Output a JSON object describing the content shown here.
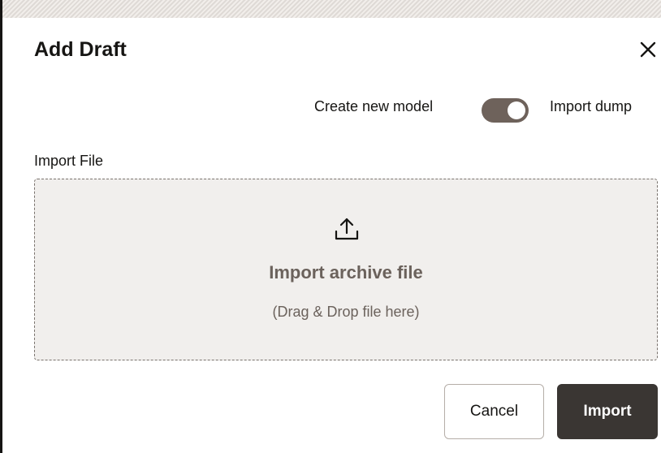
{
  "dialog": {
    "title": "Add Draft",
    "close_icon": "close-icon"
  },
  "mode_toggle": {
    "left_label": "Create new model",
    "right_label": "Import dump",
    "state": "on",
    "track_color": "#6e625b"
  },
  "import_file": {
    "label": "Import File",
    "upload_icon": "upload-icon",
    "dropzone_title": "Import archive file",
    "dropzone_hint": "(Drag & Drop file here)"
  },
  "actions": {
    "cancel_label": "Cancel",
    "import_label": "Import"
  },
  "colors": {
    "primary_button": "#3a3633",
    "dropzone_bg": "#f1efed",
    "muted_text": "#6b625c"
  }
}
